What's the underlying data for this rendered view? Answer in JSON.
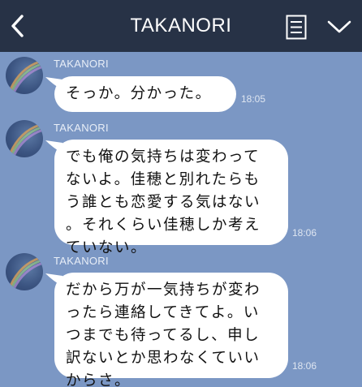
{
  "header": {
    "title": "TAKANORI"
  },
  "colors": {
    "header_bg": "#273246",
    "chat_bg": "#7b97c4",
    "bubble_bg": "#ffffff",
    "text": "#111111"
  },
  "icons": {
    "back": "chevron-left-icon",
    "menu": "document-list-icon",
    "more": "chevron-down-icon"
  },
  "messages": [
    {
      "sender": "TAKANORI",
      "text": "そっか。分かった。",
      "time": "18:05"
    },
    {
      "sender": "TAKANORI",
      "text": "でも俺の気持ちは変わって\nないよ。佳穂と別れたらも\nう誰とも恋愛する気はない\n。それくらい佳穂しか考え\nていない。",
      "time": "18:06"
    },
    {
      "sender": "TAKANORI",
      "text": "だから万が一気持ちが変わ\nったら連絡してきてよ。い\nつまでも待ってるし、申し\n訳ないとか思わなくていい\nからさ。",
      "time": "18:06"
    }
  ]
}
